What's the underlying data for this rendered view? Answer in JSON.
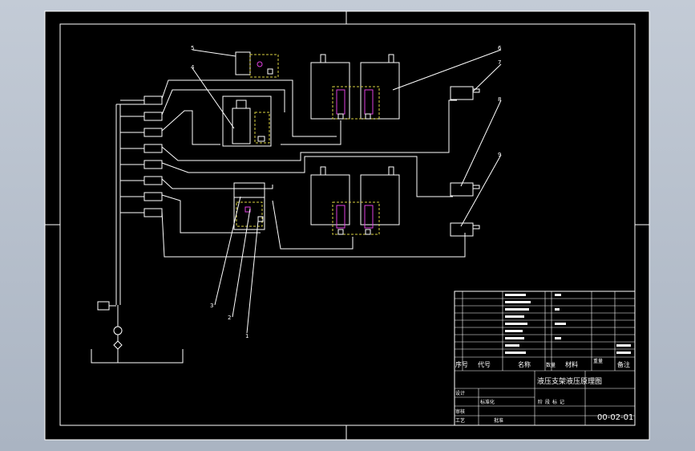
{
  "drawing": {
    "callouts": [
      "1",
      "2",
      "3",
      "4",
      "5",
      "6",
      "7",
      "8",
      "9"
    ],
    "bom_title_row": {
      "no": "序号",
      "code": "代号",
      "name": "名称",
      "qty": "数量",
      "material": "材料",
      "weight": "重量",
      "remark": "备注"
    },
    "drawing_title": "液压支架液压原理图",
    "drawing_number": "00-02-01",
    "sign_labels": {
      "design": "设计",
      "check": "审核",
      "process": "工艺",
      "approve": "批准",
      "standard": "标准化"
    },
    "stage_labels": [
      "阶",
      "段",
      "标",
      "记"
    ]
  },
  "colors": {
    "background": "#000000",
    "lines": "#ffffff",
    "dashed_boxes": "#d8d040",
    "magenta": "#e040e0",
    "frame_outer": "#c3cbd6"
  }
}
